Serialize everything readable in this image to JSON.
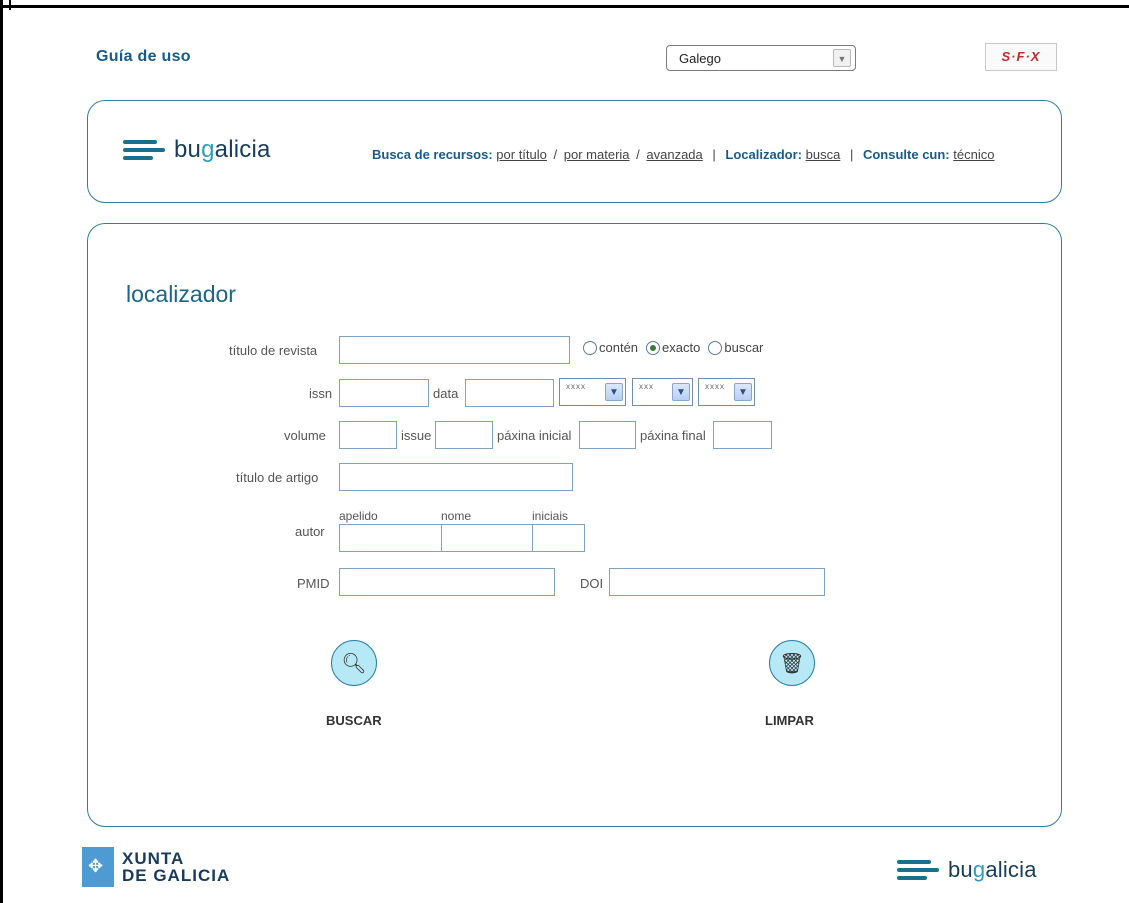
{
  "top": {
    "guide_link": "Guía de uso",
    "language_selected": "Galego",
    "sfx_logo_text": "S·F·X"
  },
  "header": {
    "brand": {
      "prefix": "bu",
      "accent": "g",
      "suffix": "alicia"
    },
    "nav": {
      "search_label": "Busca de recursos:",
      "by_title": "por título",
      "by_subject": "por materia",
      "advanced": "avanzada",
      "locator_label": "Localizador:",
      "locator_search": "busca",
      "consult_label": "Consulte cun:",
      "technician": "técnico",
      "separator_slash": "/",
      "separator_bar": "|"
    }
  },
  "form": {
    "title": "localizador",
    "journal_title_label": "título de revista",
    "radio_options": [
      {
        "label": "contén",
        "selected": false
      },
      {
        "label": "exacto",
        "selected": true
      },
      {
        "label": "buscar",
        "selected": false
      }
    ],
    "issn_label": "issn",
    "date_label": "data",
    "date_selects": [
      "xxxx",
      "xxx",
      "xxxx"
    ],
    "volume_label": "volume",
    "issue_label": "issue",
    "start_page_label": "páxina inicial",
    "end_page_label": "páxina final",
    "article_title_label": "título de artigo",
    "author_label": "autor",
    "surname_label": "apelido",
    "name_label": "nome",
    "initials_label": "iniciais",
    "pmid_label": "PMID",
    "doi_label": "DOI",
    "search_button": "BUSCAR",
    "clear_button": "LIMPAR"
  },
  "footer": {
    "xunta_line1": "XUNTA",
    "xunta_line2": "DE GALICIA",
    "brand": {
      "prefix": "bu",
      "accent": "g",
      "suffix": "alicia"
    }
  },
  "colors": {
    "accent": "#2e7fa2",
    "link_blue": "#1a5a8a",
    "button_fill": "#b6e8f6"
  }
}
